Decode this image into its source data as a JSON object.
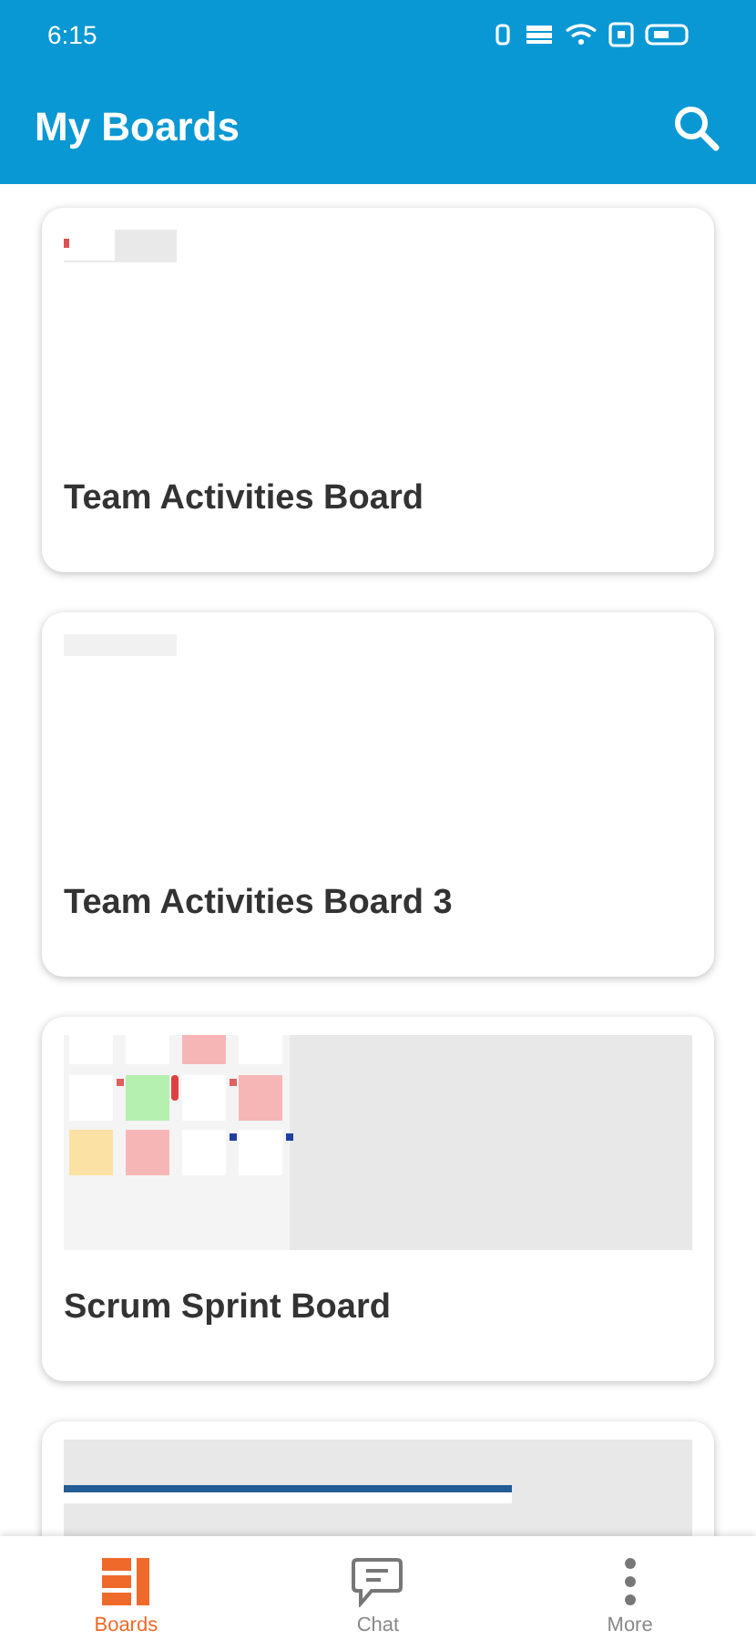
{
  "status_bar": {
    "time": "6:15"
  },
  "app_bar": {
    "title": "My Boards"
  },
  "boards": [
    {
      "title": "Team Activities Board",
      "kind": "sparse"
    },
    {
      "title": "Team Activities Board 3",
      "kind": "blank"
    },
    {
      "title": "Scrum Sprint Board",
      "kind": "notes"
    },
    {
      "kind": "banner"
    }
  ],
  "nav": [
    {
      "label": "Boards",
      "kind": "boards",
      "selected": true
    },
    {
      "label": "Chat",
      "kind": "chat",
      "selected": false
    },
    {
      "label": "More",
      "kind": "more",
      "selected": false
    }
  ]
}
